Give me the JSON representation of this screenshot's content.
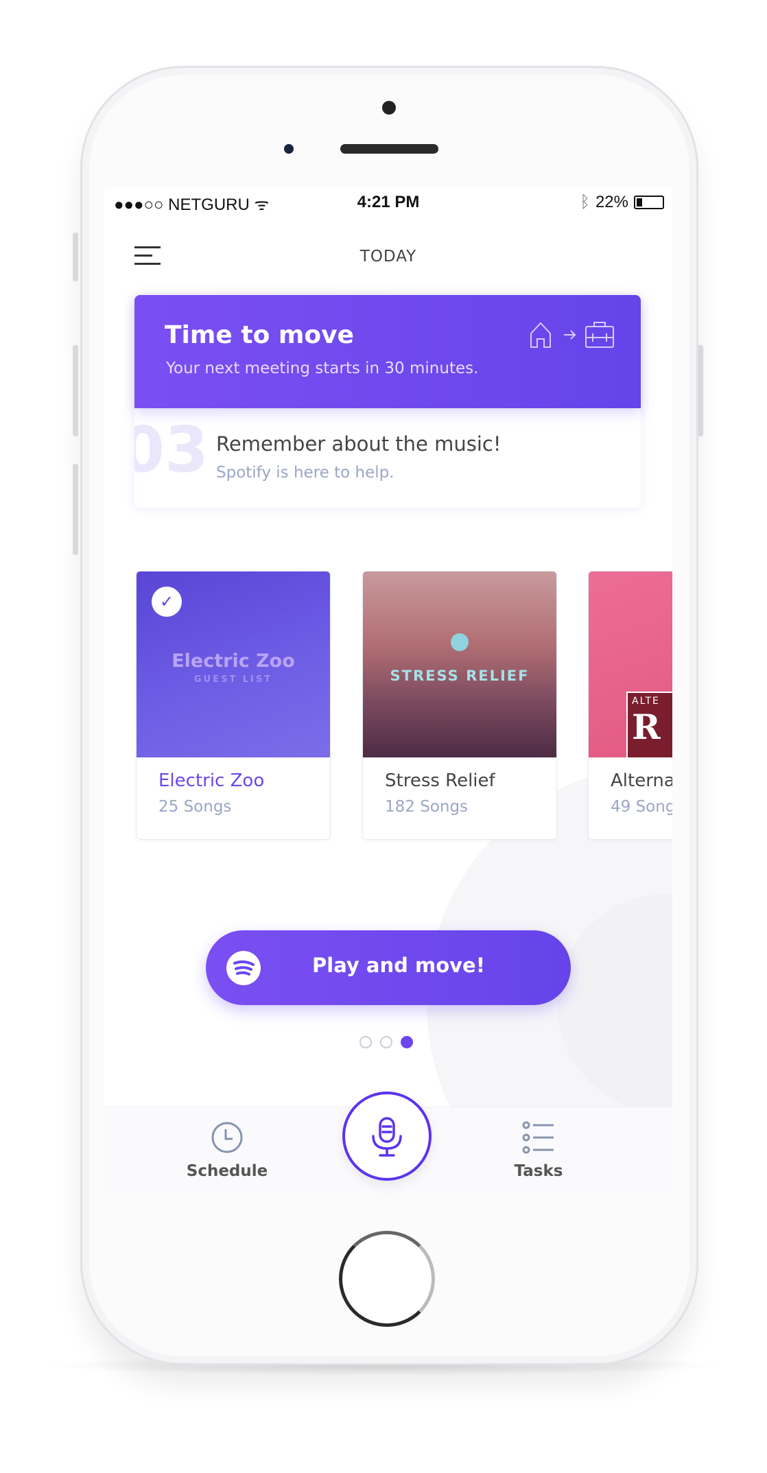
{
  "status_bar": {
    "carrier": "●●●○○ NETGURU",
    "time": "4:21 PM",
    "battery": "22%",
    "icons": [
      "wifi-icon",
      "bluetooth-icon",
      "battery-icon"
    ]
  },
  "header": {
    "title": "TODAY",
    "menu_icon": "hamburger-icon"
  },
  "alert": {
    "title": "Time to move",
    "subtitle": "Your next meeting starts in 30 minutes.",
    "icons": [
      "home-icon",
      "arrow-right-icon",
      "briefcase-icon"
    ]
  },
  "step": {
    "number": "03",
    "title": "Remember about the music!",
    "subtitle": "Spotify is here to help."
  },
  "playlists": [
    {
      "name": "Electric Zoo",
      "count": "25 Songs",
      "selected": true,
      "cover_text": "Electric Zoo",
      "cover_sub": "GUEST LIST"
    },
    {
      "name": "Stress Relief",
      "count": "182 Songs",
      "selected": false,
      "cover_text": "STRESS RELIEF"
    },
    {
      "name": "Alterna",
      "count": "49 Song",
      "selected": false,
      "cover_text": "ALTE",
      "cover_big": "R"
    }
  ],
  "play_button": {
    "label": "Play and move!",
    "icon": "spotify-icon"
  },
  "pager": {
    "count": 3,
    "active": 3
  },
  "tabbar": {
    "schedule": "Schedule",
    "tasks": "Tasks",
    "mic_icon": "microphone-icon"
  },
  "colors": {
    "accent": "#6a46ee",
    "muted": "#9aa6c6"
  }
}
